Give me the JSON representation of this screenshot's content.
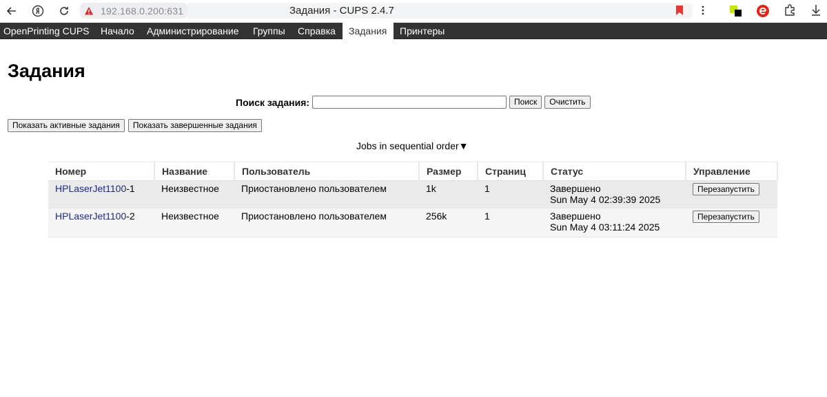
{
  "browser": {
    "address": "192.168.0.200:631",
    "tab_title": "Задания - CUPS 2.4.7"
  },
  "nav": {
    "items": [
      "OpenPrinting CUPS",
      "Начало",
      "Администрирование",
      "Группы",
      "Справка",
      "Задания",
      "Принтеры"
    ],
    "active": "Задания"
  },
  "page": {
    "title": "Задания",
    "search_label": "Поиск задания:",
    "search_value": "",
    "search_button": "Поиск",
    "clear_button": "Очистить",
    "show_active_button": "Показать активные задания",
    "show_completed_button": "Показать завершенные задания",
    "sort_label": "Jobs in sequential order▼"
  },
  "table": {
    "headers": [
      "Номер",
      "Название",
      "Пользователь",
      "Размер",
      "Страниц",
      "Статус",
      "Управление"
    ],
    "rows": [
      {
        "printer": "HPLaserJet1100",
        "job_suffix": "-1",
        "name": "Неизвестное",
        "user": "Приостановлено пользователем",
        "size": "1k",
        "pages": "1",
        "status": "Завершено",
        "status_time": "Sun May 4 02:39:39 2025",
        "action": "Перезапустить"
      },
      {
        "printer": "HPLaserJet1100",
        "job_suffix": "-2",
        "name": "Неизвестное",
        "user": "Приостановлено пользователем",
        "size": "256k",
        "pages": "1",
        "status": "Завершено",
        "status_time": "Sun May 4 03:11:24 2025",
        "action": "Перезапустить"
      }
    ]
  }
}
